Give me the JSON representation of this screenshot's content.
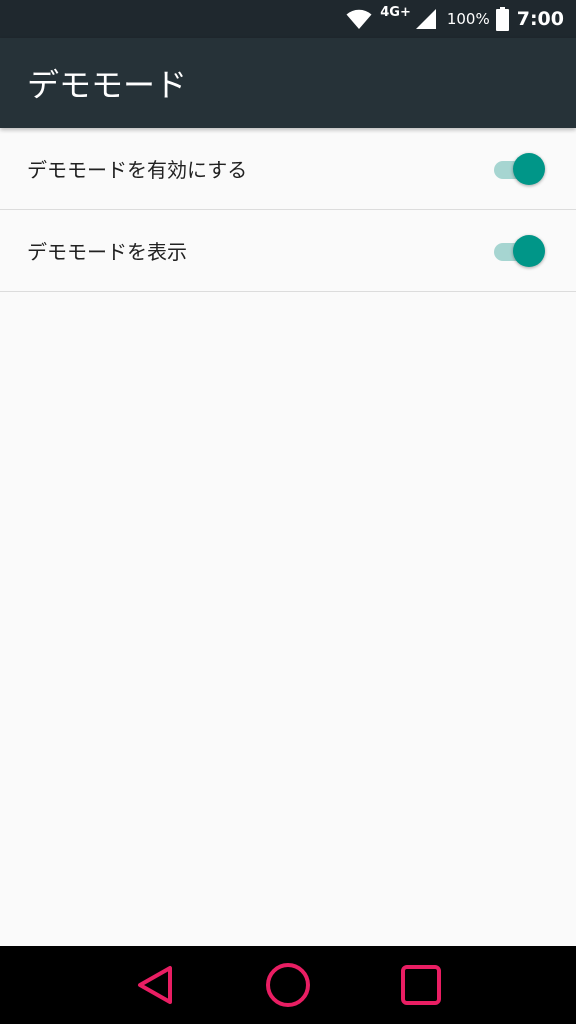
{
  "status_bar": {
    "network": "4G+",
    "battery_percent": "100%",
    "time": "7:00",
    "icons": [
      "wifi-icon",
      "cell-signal-icon",
      "battery-icon"
    ]
  },
  "app_bar": {
    "title": "デモモード"
  },
  "settings": [
    {
      "label": "デモモードを有効にする",
      "enabled": true
    },
    {
      "label": "デモモードを表示",
      "enabled": true
    }
  ],
  "navigation": {
    "buttons": [
      "back-icon",
      "home-icon",
      "recents-icon"
    ],
    "accent_color": "#e91e63"
  },
  "colors": {
    "app_bar": "#263238",
    "status_bar": "#1f282e",
    "switch_thumb": "#009688",
    "switch_track": "#a6d5d1"
  }
}
